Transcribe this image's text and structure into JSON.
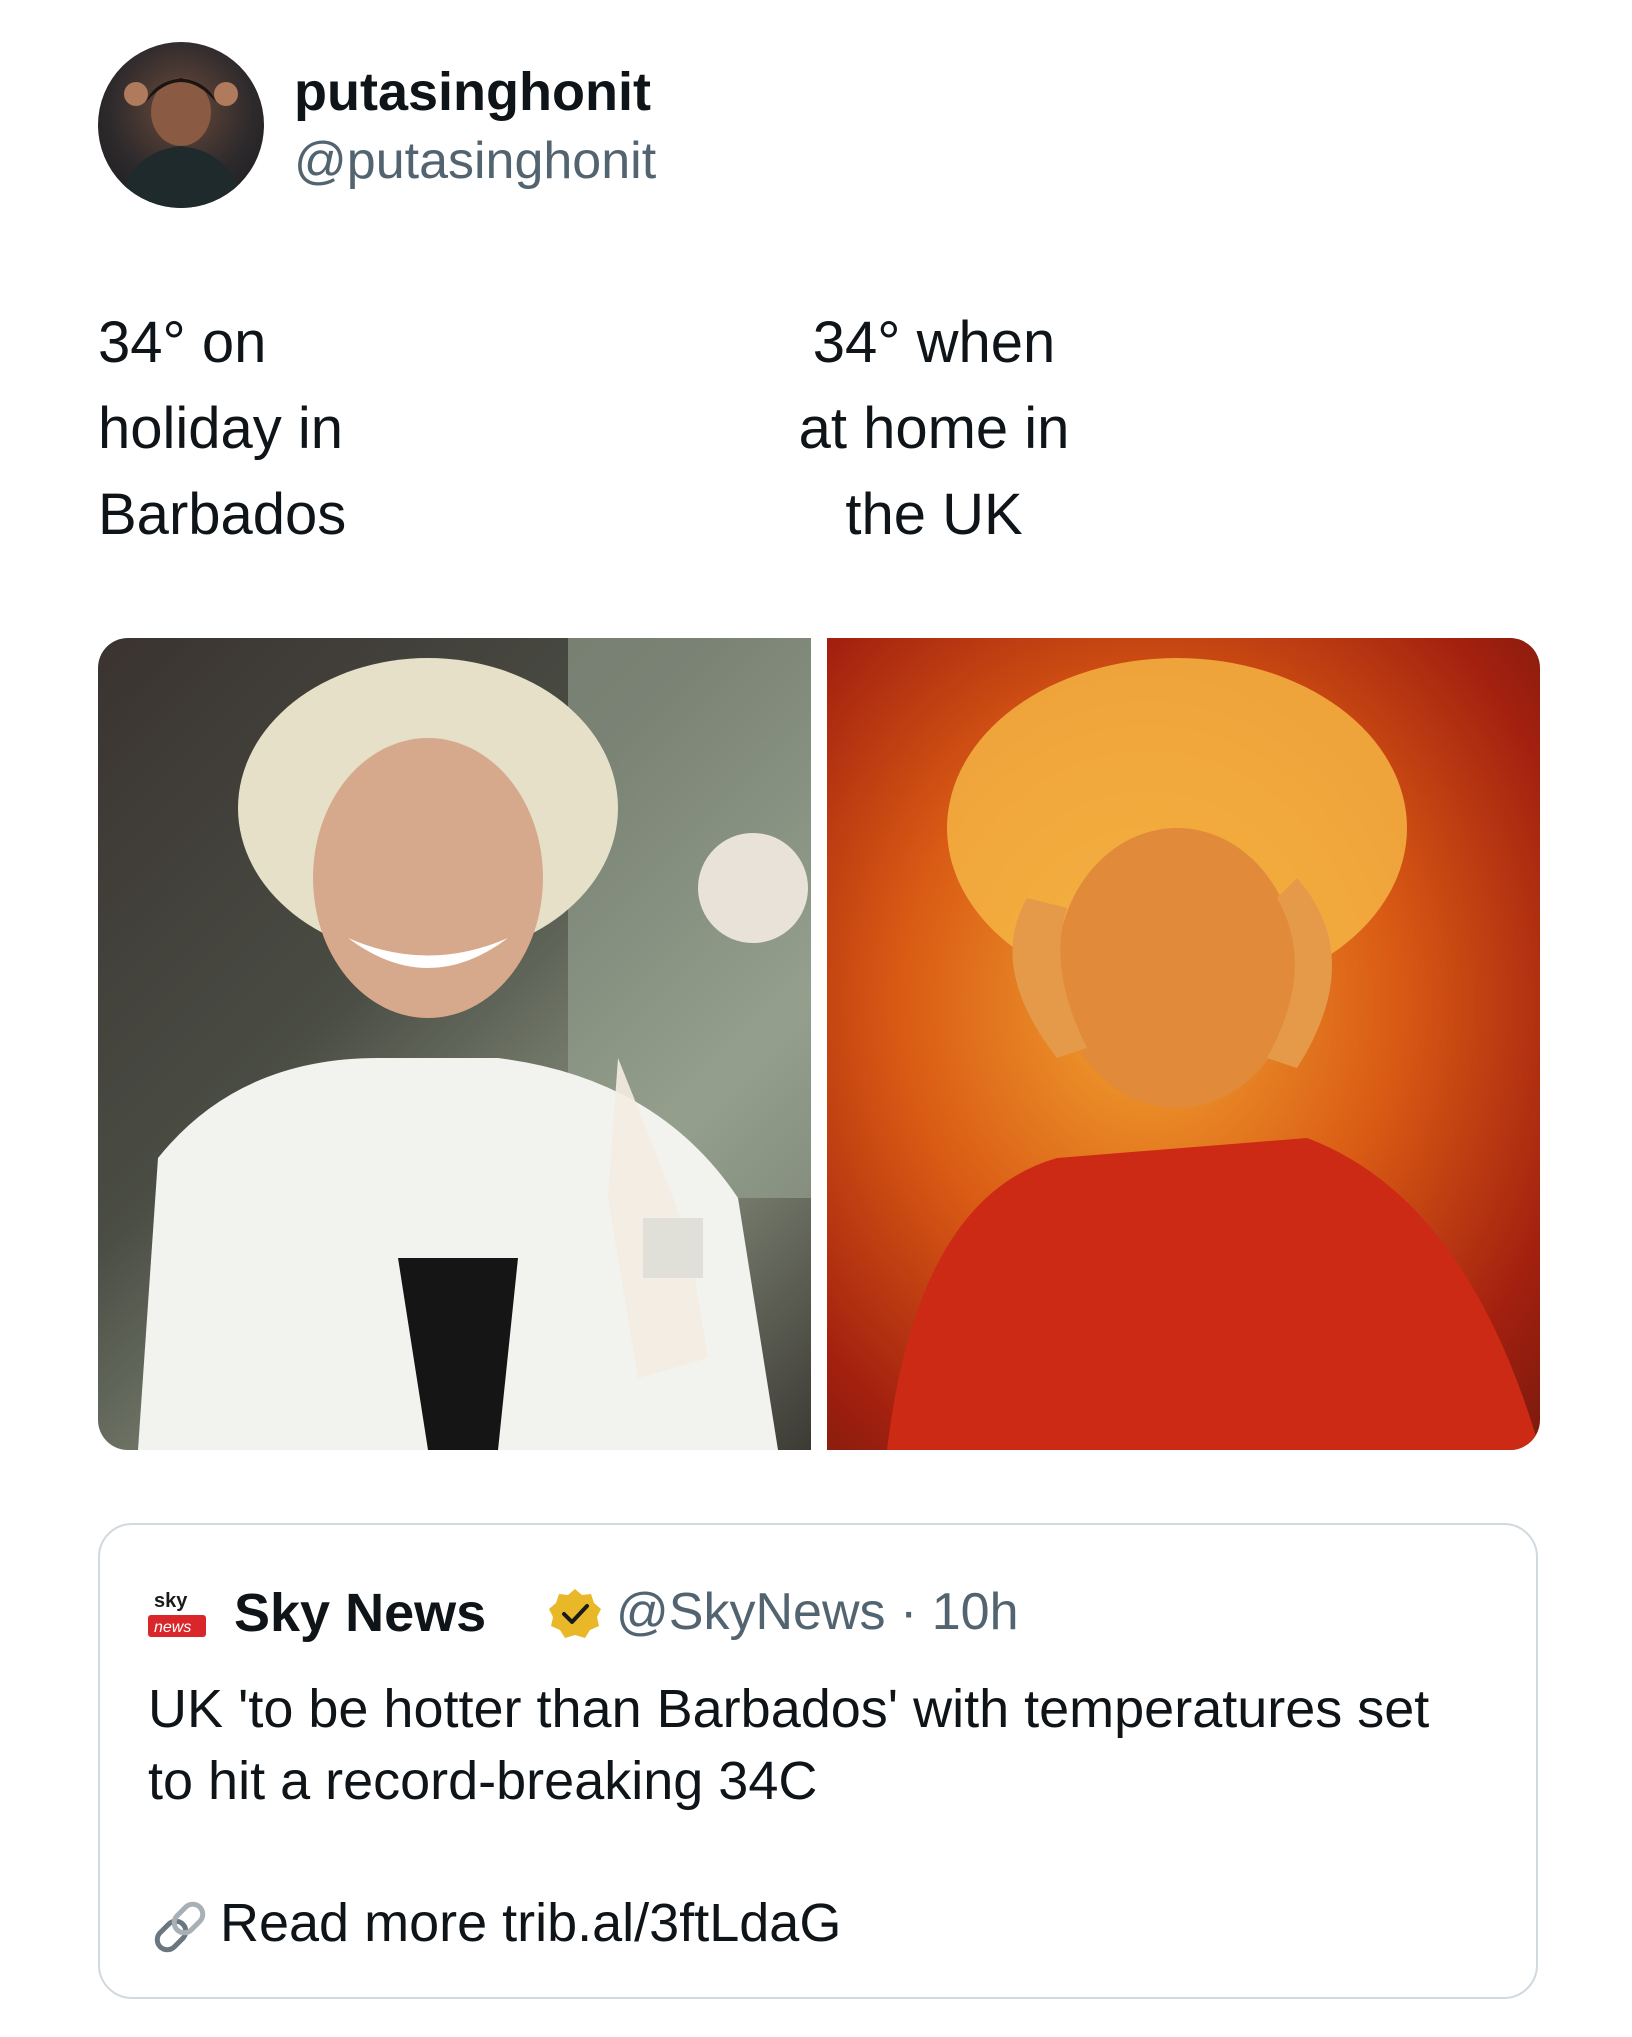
{
  "post": {
    "display_name": "putasinghonit",
    "handle": "@putasinghonit",
    "captions": {
      "left": "34° on\nholiday in\nBarbados",
      "right": "34° when\nat home in\nthe UK"
    }
  },
  "quoted_post": {
    "logo_text_top": "sky",
    "logo_text_bottom": "news",
    "display_name": "Sky News",
    "handle": "@SkyNews",
    "separator": "·",
    "timestamp": "10h",
    "text": "UK 'to be hotter than Barbados' with temperatures set to hit a record-breaking 34C",
    "link_text": "Read more trib.al/3ftLdaG"
  },
  "icons": {
    "avatar": "avatar-photo",
    "verified": "verified-badge-icon",
    "link": "link-icon"
  },
  "colors": {
    "text": "#0f1419",
    "secondary": "#536471",
    "border": "#cfd9de",
    "verified_gold": "#e8b829",
    "sky_red": "#d9262b"
  }
}
